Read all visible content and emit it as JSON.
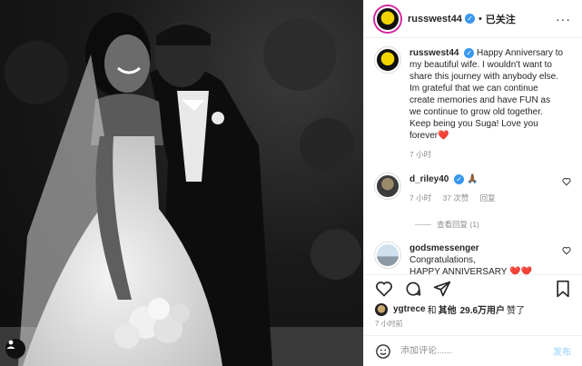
{
  "post": {
    "username": "russwest44",
    "follow_label": "已关注",
    "dot": "•",
    "more": "···"
  },
  "caption": {
    "username": "russwest44",
    "text": "Happy Anniversary to my beautiful wife. I wouldn't want to share this journey with anybody else. Im grateful that we can continue create memories and have FUN as we continue to grow old together. Keep being you Suga! Love you forever",
    "emoji": "❤️",
    "time": "7 小时"
  },
  "comments": [
    {
      "username": "d_riley40",
      "text": "🙏🏾",
      "time": "7 小时",
      "likes": "37 次赞",
      "reply": "回复",
      "view_replies": "查看回复 (1)"
    },
    {
      "username": "godsmessenger",
      "text_line1": "Congratulations,",
      "text_line2": "HAPPY ANNIVERSARY",
      "emoji": "❤️❤️"
    }
  ],
  "likes": {
    "user": "ygtrece",
    "and": "和",
    "others": "其他",
    "count": "29.6万用户",
    "suffix": "赞了"
  },
  "time_ago": "7 小时前",
  "add_comment": {
    "placeholder": "添加评论......",
    "post_label": "发布"
  },
  "icons": {
    "like": "heart-outline-icon",
    "comment": "comment-bubble-icon",
    "share": "paper-plane-icon",
    "save": "bookmark-icon",
    "emoji": "smiley-icon",
    "tag": "user-tag-icon"
  },
  "colors": {
    "verified": "#3897f0",
    "heart": "#ed4956",
    "post_button": "#b2dffc"
  }
}
